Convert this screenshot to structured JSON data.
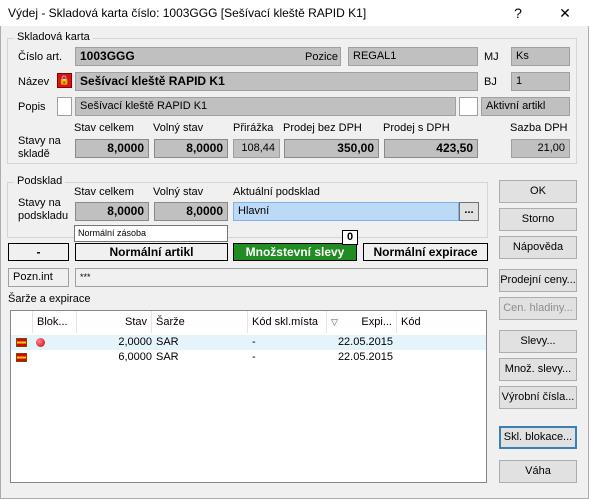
{
  "window": {
    "title": "Výdej - Skladová karta číslo: 1003GGG [Sešívací kleště RAPID K1]",
    "help": "?",
    "close": "✕"
  },
  "card": {
    "group_label": "Skladová karta",
    "cislo_label": "Číslo art.",
    "cislo": "1003GGG",
    "pozice_label": "Pozice",
    "pozice": "REGAL1",
    "mj_label": "MJ",
    "mj": "Ks",
    "nazev_label": "Název",
    "nazev": "Sešívací kleště RAPID K1",
    "bj_label": "BJ",
    "bj": "1",
    "popis_label": "Popis",
    "popis": "Sešívací kleště RAPID K1",
    "aktivni": "Aktivní artikl",
    "stavy_label_1": "Stavy na",
    "stavy_label_2": "skladě",
    "stav_celkem_label": "Stav celkem",
    "stav_celkem": "8,0000",
    "volny_stav_label": "Volný stav",
    "volny_stav": "8,0000",
    "prirazka_label": "Přirážka",
    "prirazka": "108,44",
    "prodej_bez_label": "Prodej bez DPH",
    "prodej_bez": "350,00",
    "prodej_s_label": "Prodej s DPH",
    "prodej_s": "423,50",
    "sazba_label": "Sazba DPH",
    "sazba": "21,00"
  },
  "podsklad": {
    "group_label": "Podsklad",
    "stavy_label_1": "Stavy na",
    "stavy_label_2": "podskladu",
    "stav_celkem_label": "Stav celkem",
    "stav_celkem": "8,0000",
    "volny_stav_label": "Volný stav",
    "volny_stav": "8,0000",
    "aktualni_label": "Aktuální podsklad",
    "aktualni": "Hlavní",
    "ellipsis": "...",
    "tooltip": "Normální zásoba"
  },
  "status": {
    "dash": "-",
    "artikl": "Normální artikl",
    "slevy": "Množstevní slevy",
    "slevy_count": "0",
    "expirace": "Normální expirace"
  },
  "pozn": {
    "label": "Pozn.int",
    "value": "***"
  },
  "sarze": {
    "label": "Šarže a expirace",
    "columns": [
      "Blok...",
      "Stav",
      "Šarže",
      "Kód skl.místa",
      "Expi...",
      "Kód"
    ],
    "sort_glyph": "▽",
    "rows": [
      {
        "stav": "2,0000",
        "sarze": "SAR",
        "kod_mista": "-",
        "expi": "22.05.2015",
        "kod": ""
      },
      {
        "stav": "6,0000",
        "sarze": "SAR",
        "kod_mista": "-",
        "expi": "22.05.2015",
        "kod": ""
      }
    ]
  },
  "buttons": {
    "ok": "OK",
    "storno": "Storno",
    "napoveda": "Nápověda",
    "prodejni_ceny": "Prodejní ceny...",
    "cen_hladiny": "Cen. hladiny...",
    "slevy": "Slevy...",
    "mnoz_slevy": "Množ. slevy...",
    "vyrobni_cisla": "Výrobní čísla...",
    "skl_blokace": "Skl. blokace...",
    "vaha": "Váha"
  },
  "colors": {
    "accent_field": "#bcd9f5",
    "slevy_bg": "#218c21",
    "selection": "#e5f3fb"
  }
}
